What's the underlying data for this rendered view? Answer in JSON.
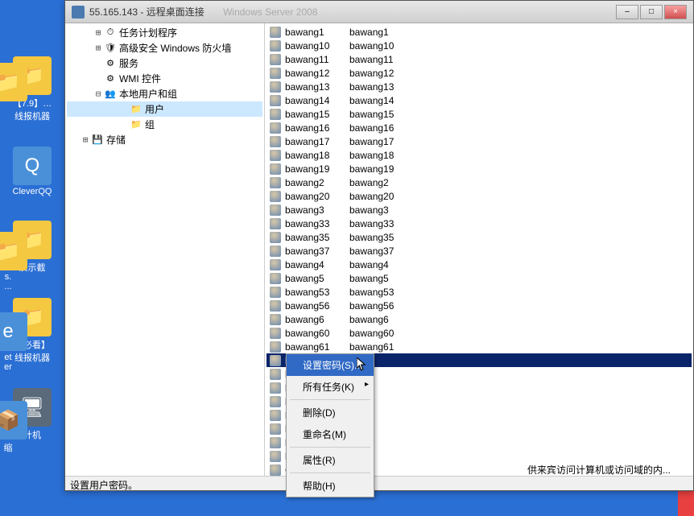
{
  "titlebar": {
    "address": "55.165.143 - 远程桌面连接",
    "center": "Windows Server 2008"
  },
  "window_controls": {
    "min": "–",
    "max": "□",
    "close": "×"
  },
  "desktop": {
    "icons": [
      {
        "label": "【7.9】…",
        "sub": "线报机器",
        "type": "folder"
      },
      {
        "label": "CleverQQ",
        "type": "blue"
      },
      {
        "label": "演示截",
        "type": "folder"
      },
      {
        "label": "【必看】",
        "sub": "线报机器",
        "type": "folder"
      },
      {
        "label": "计机",
        "type": "computer"
      }
    ],
    "left_icons": [
      {
        "label": "s. ...",
        "type": "folder"
      },
      {
        "label": "et",
        "sub": "er",
        "type": "ie"
      },
      {
        "label": "缩",
        "type": "blue"
      }
    ]
  },
  "tree": {
    "items": [
      {
        "expander": "⊞",
        "icon": "⏱",
        "label": "任务计划程序",
        "indent": 2
      },
      {
        "expander": "⊞",
        "icon": "🛡",
        "label": "高级安全 Windows 防火墙",
        "indent": 2
      },
      {
        "expander": "",
        "icon": "⚙",
        "label": "服务",
        "indent": 2
      },
      {
        "expander": "",
        "icon": "⚙",
        "label": "WMI 控件",
        "indent": 2
      },
      {
        "expander": "⊟",
        "icon": "👥",
        "label": "本地用户和组",
        "indent": 2
      },
      {
        "expander": "",
        "icon": "📁",
        "label": "用户",
        "indent": 4,
        "selected": true
      },
      {
        "expander": "",
        "icon": "📁",
        "label": "组",
        "indent": 4
      },
      {
        "expander": "⊞",
        "icon": "💾",
        "label": "存储",
        "indent": 1
      }
    ]
  },
  "users": {
    "rows": [
      {
        "name": "bawang1",
        "full": "bawang1"
      },
      {
        "name": "bawang10",
        "full": "bawang10"
      },
      {
        "name": "bawang11",
        "full": "bawang11"
      },
      {
        "name": "bawang12",
        "full": "bawang12"
      },
      {
        "name": "bawang13",
        "full": "bawang13"
      },
      {
        "name": "bawang14",
        "full": "bawang14"
      },
      {
        "name": "bawang15",
        "full": "bawang15"
      },
      {
        "name": "bawang16",
        "full": "bawang16"
      },
      {
        "name": "bawang17",
        "full": "bawang17"
      },
      {
        "name": "bawang18",
        "full": "bawang18"
      },
      {
        "name": "bawang19",
        "full": "bawang19"
      },
      {
        "name": "bawang2",
        "full": "bawang2"
      },
      {
        "name": "bawang20",
        "full": "bawang20"
      },
      {
        "name": "bawang3",
        "full": "bawang3"
      },
      {
        "name": "bawang33",
        "full": "bawang33"
      },
      {
        "name": "bawang35",
        "full": "bawang35"
      },
      {
        "name": "bawang37",
        "full": "bawang37"
      },
      {
        "name": "bawang4",
        "full": "bawang4"
      },
      {
        "name": "bawang5",
        "full": "bawang5"
      },
      {
        "name": "bawang53",
        "full": "bawang53"
      },
      {
        "name": "bawang56",
        "full": "bawang56"
      },
      {
        "name": "bawang6",
        "full": "bawang6"
      },
      {
        "name": "bawang60",
        "full": "bawang60"
      },
      {
        "name": "bawang61",
        "full": "bawang61"
      },
      {
        "name": "baw",
        "full": "",
        "selected": true
      },
      {
        "name": "baw",
        "full": ""
      },
      {
        "name": "baw",
        "full": ""
      },
      {
        "name": "baw",
        "full": ""
      },
      {
        "name": "baw",
        "full": ""
      },
      {
        "name": "baw",
        "full": ""
      },
      {
        "name": "baw",
        "full": ""
      },
      {
        "name": "baw",
        "full": ""
      },
      {
        "name": "Gue",
        "full": "",
        "desc": "供来宾访问计算机或访问域的内..."
      }
    ]
  },
  "context_menu": {
    "items": [
      {
        "label": "设置密码(S)...",
        "highlighted": true
      },
      {
        "label": "所有任务(K)",
        "submenu": true
      },
      {
        "sep": true
      },
      {
        "label": "删除(D)"
      },
      {
        "label": "重命名(M)"
      },
      {
        "sep": true
      },
      {
        "label": "属性(R)"
      },
      {
        "sep": true
      },
      {
        "label": "帮助(H)"
      }
    ]
  },
  "statusbar": {
    "text": "设置用户密码。"
  }
}
